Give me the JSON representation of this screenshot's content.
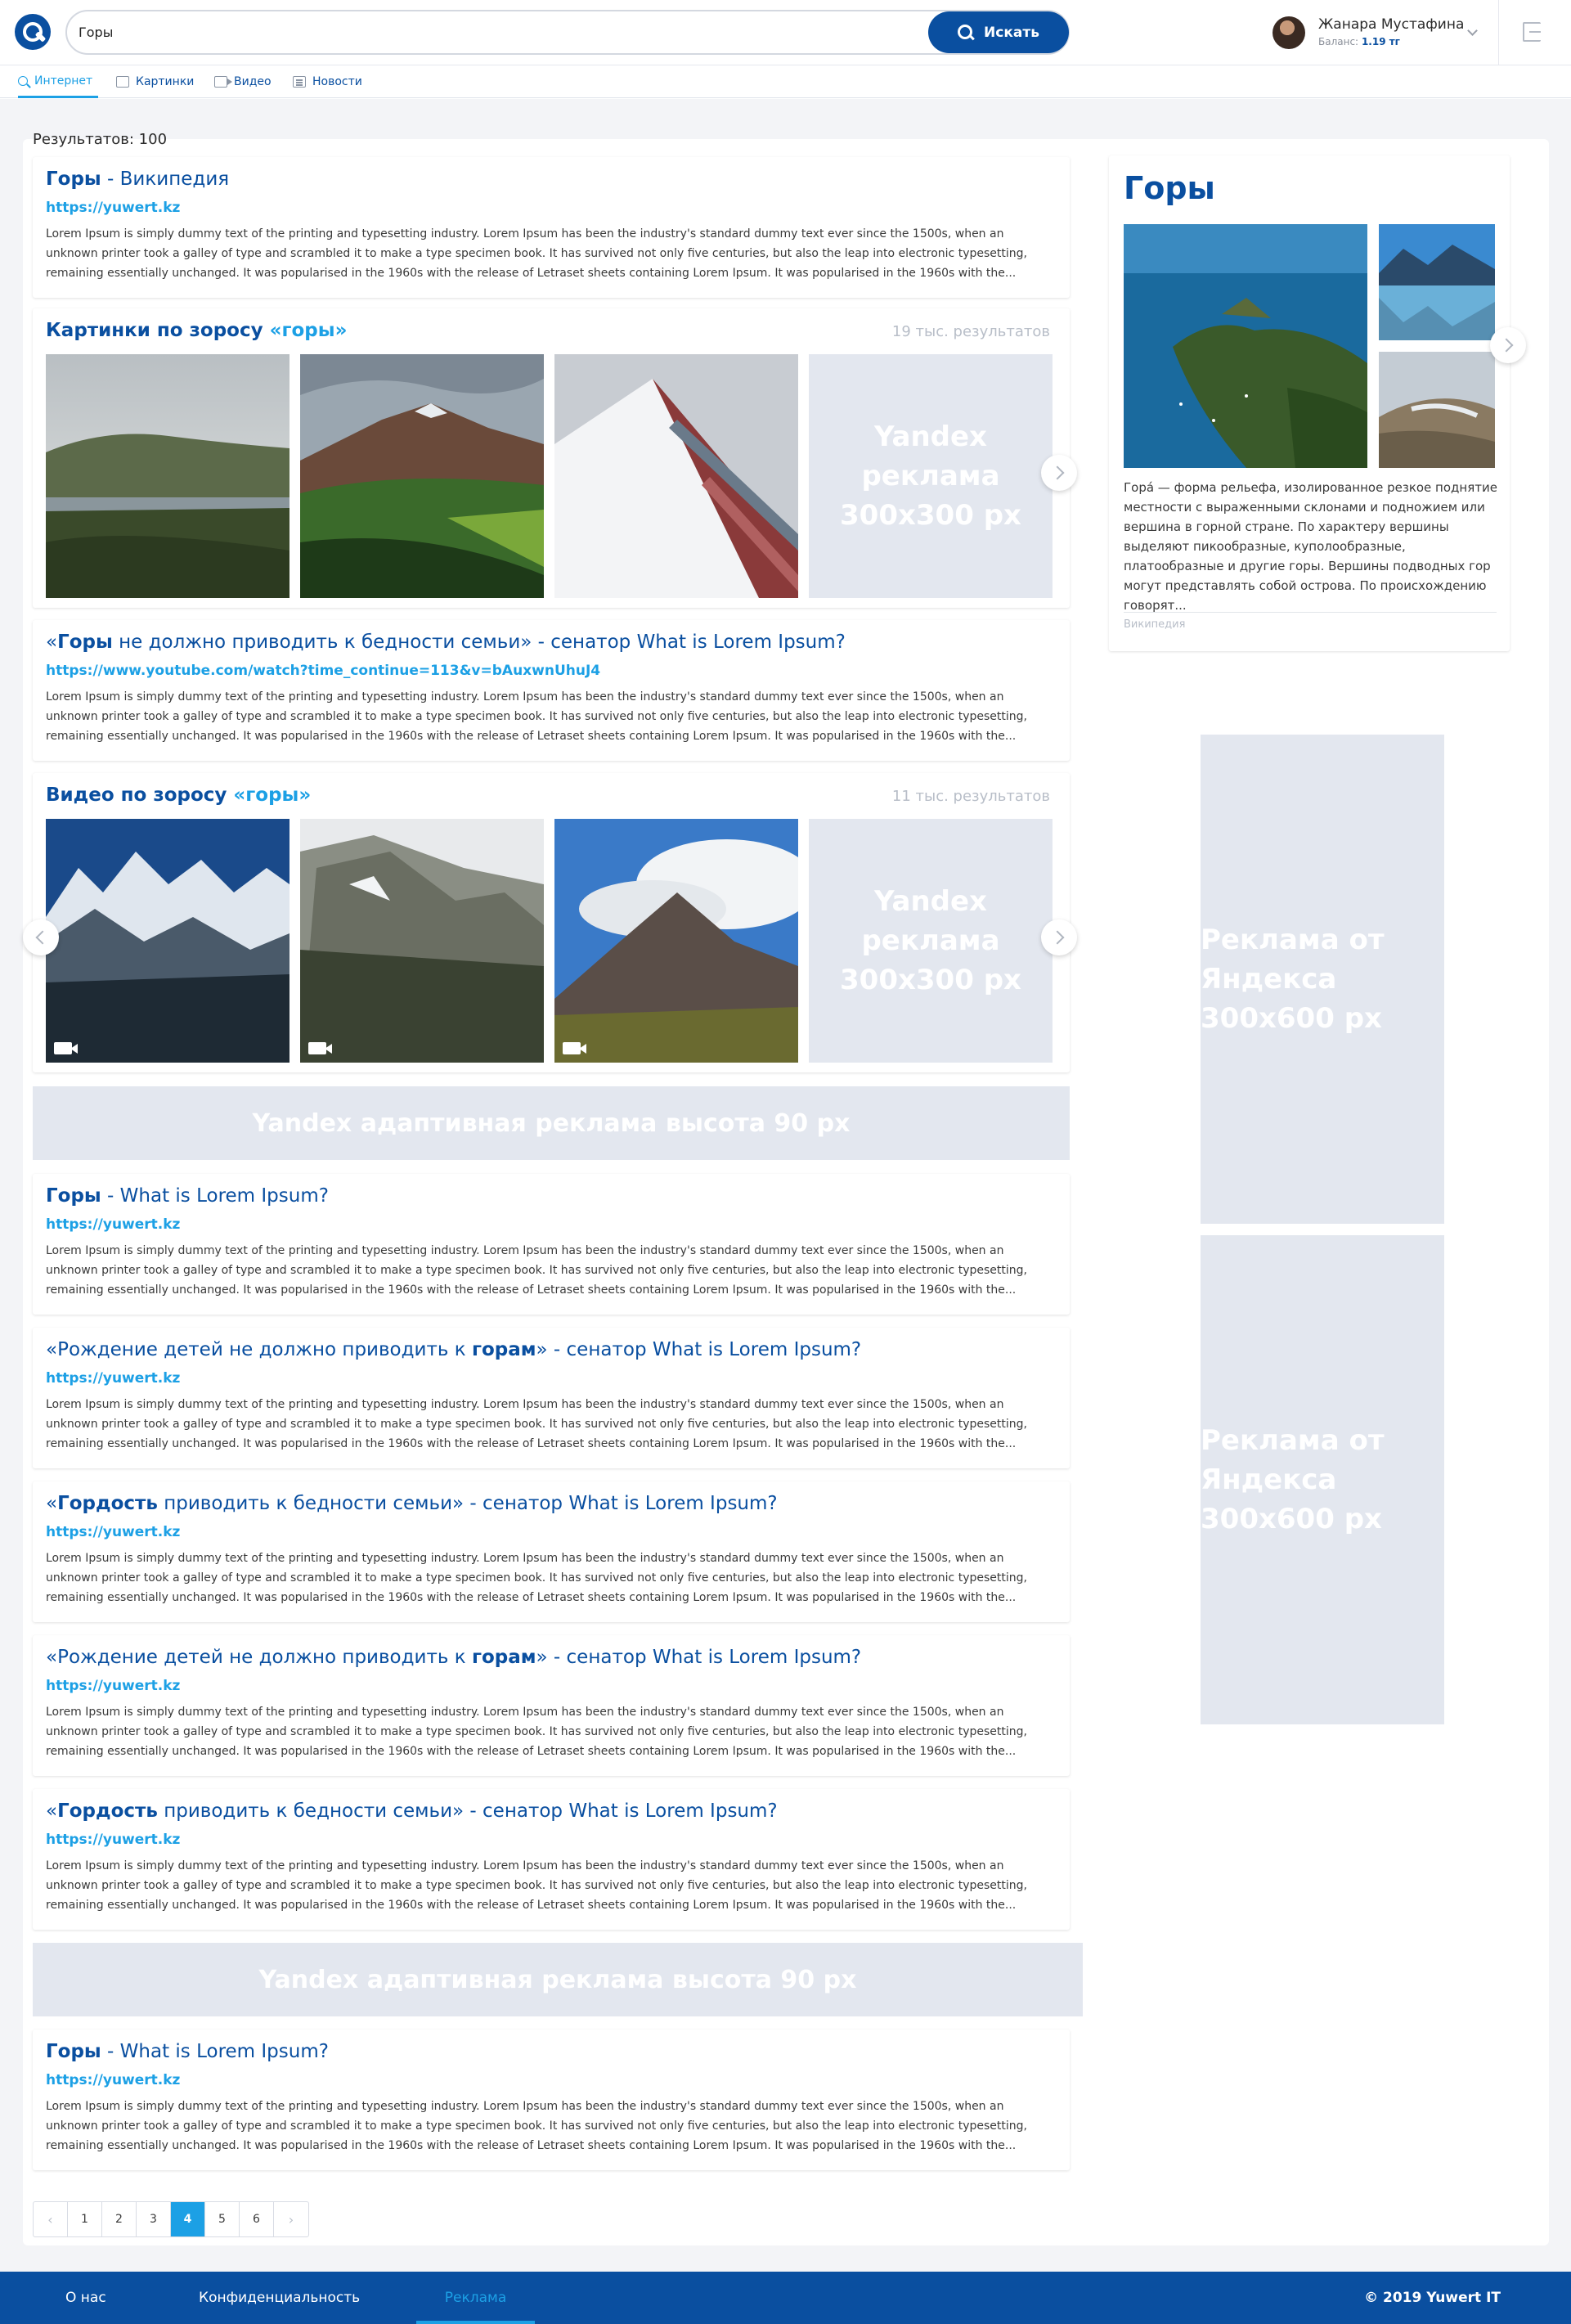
{
  "header": {
    "search_value": "Горы",
    "search_button": "Искать",
    "user_name": "Жанара Мустафина",
    "balance_label": "Баланс:",
    "balance_value": "1.19 тг"
  },
  "tabs": [
    {
      "label": "Интернет",
      "icon": "search-icon",
      "active": true
    },
    {
      "label": "Картинки",
      "icon": "image-icon"
    },
    {
      "label": "Видео",
      "icon": "video-icon"
    },
    {
      "label": "Новости",
      "icon": "news-icon"
    }
  ],
  "results_count": "Результатов: 100",
  "snippet": "Lorem Ipsum is simply dummy text of the printing and typesetting industry. Lorem Ipsum has been the industry's standard dummy text ever since the 1500s, when an unknown printer took a galley of type and scrambled it to make a type specimen book. It has survived not only five centuries, but also the leap into electronic typesetting, remaining essentially unchanged. It was popularised in the 1960s with the release of Letraset sheets containing Lorem Ipsum. It was popularised in the 1960s with the...",
  "results": [
    {
      "title_bold": "Горы",
      "title_rest": " - Википедия",
      "url": "https://yuwert.kz"
    },
    {
      "title_pre": "«",
      "title_bold": "Горы",
      "title_rest": " не должно приводить к бедности семьи» - сенатор What is Lorem Ipsum?",
      "url": "https://www.youtube.com/watch?time_continue=113&v=bAuxwnUhuJ4"
    },
    {
      "title_bold": "Горы",
      "title_rest": " - What is Lorem Ipsum?",
      "url": "https://yuwert.kz"
    },
    {
      "title_pre": "«Рождение детей не должно приводить к ",
      "title_bold": "горам",
      "title_rest": "» - сенатор What is Lorem Ipsum?",
      "url": "https://yuwert.kz"
    },
    {
      "title_pre": "«",
      "title_bold": "Гордость",
      "title_rest": " приводить к бедности семьи» - сенатор What is Lorem Ipsum?",
      "url": "https://yuwert.kz"
    },
    {
      "title_pre": "«Рождение детей не должно приводить к ",
      "title_bold": "горам",
      "title_rest": "» - сенатор What is Lorem Ipsum?",
      "url": "https://yuwert.kz"
    },
    {
      "title_pre": "«",
      "title_bold": "Гордость",
      "title_rest": " приводить к бедности семьи» - сенатор What is Lorem Ipsum?",
      "url": "https://yuwert.kz"
    },
    {
      "title_bold": "Горы",
      "title_rest": " - What is Lorem Ipsum?",
      "url": "https://yuwert.kz"
    }
  ],
  "images_block": {
    "title": "Картинки по зоросу ",
    "query": "«горы»",
    "count": "19 тыс. результатов",
    "ad": "Yandex реклама 300x300 px"
  },
  "videos_block": {
    "title": "Видео по зоросу ",
    "query": "«горы»",
    "count": "11 тыс. результатов",
    "ad": "Yandex реклама 300x300 px"
  },
  "wide_ad": "Yandex адаптивная реклама высота 90 px",
  "knowledge": {
    "title": "Горы",
    "text": "Гора́ — форма рельефа, изолированное резкое поднятие местности с выраженными склонами и подножием или вершина в горной стране. По характеру вершины выделяют пикообразные, куполообразные, платообразные и другие горы. Вершины подводных гор могут представлять собой острова. По происхождению говорят...",
    "source": "Википедия"
  },
  "side_ad": "Реклама от Яндекса 300x600 px",
  "pagination": {
    "pages": [
      "1",
      "2",
      "3",
      "4",
      "5",
      "6"
    ],
    "current": "4",
    "prev": "‹",
    "next": "›"
  },
  "footer": {
    "links": [
      "О нас",
      "Конфиденциальность",
      "Реклама"
    ],
    "active": "Реклама",
    "copyright": "© 2019 Yuwert IT"
  },
  "colors": {
    "brand": "#0a4fa0",
    "accent": "#1ca0e5",
    "ad_placeholder": "#e3e7ef"
  }
}
